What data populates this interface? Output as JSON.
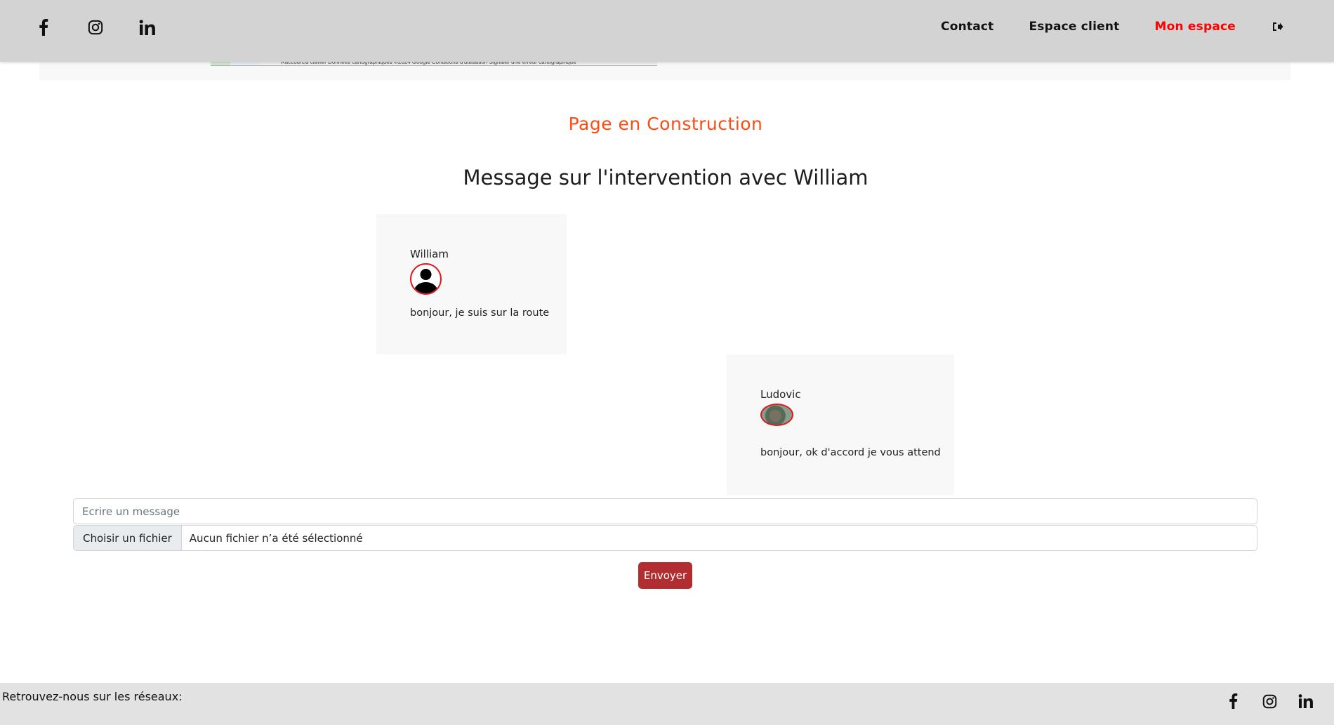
{
  "header": {
    "social_icons": [
      "facebook-icon",
      "instagram-icon",
      "linkedin-icon"
    ],
    "nav": {
      "contact": "Contact",
      "espace_client": "Espace client",
      "mon_espace": "Mon espace"
    },
    "logout_icon": "sign-out-icon",
    "active_color": "#ff0000"
  },
  "map_attribution": "Raccourcis clavier   Données cartographiques ©2024 Google   Conditions d'utilisation   Signaler une erreur cartographique",
  "main": {
    "construction_title": "Page en Construction",
    "conversation_title": "Message sur l'intervention avec William",
    "messages": [
      {
        "author": "William",
        "avatar": "default-user-avatar",
        "text": "bonjour, je suis sur la route"
      },
      {
        "author": "Ludovic",
        "avatar": "photo-avatar",
        "text": "bonjour, ok d'accord je vous attend"
      }
    ]
  },
  "form": {
    "message_placeholder": "Ecrire un message",
    "file_button": "Choisir un fichier",
    "file_status": "Aucun fichier n’a été sélectionné",
    "send_label": "Envoyer",
    "send_color": "#b12d2f"
  },
  "footer": {
    "text": "Retrouvez-nous sur les réseaux:",
    "social_icons": [
      "facebook-icon",
      "instagram-icon",
      "linkedin-icon"
    ]
  }
}
